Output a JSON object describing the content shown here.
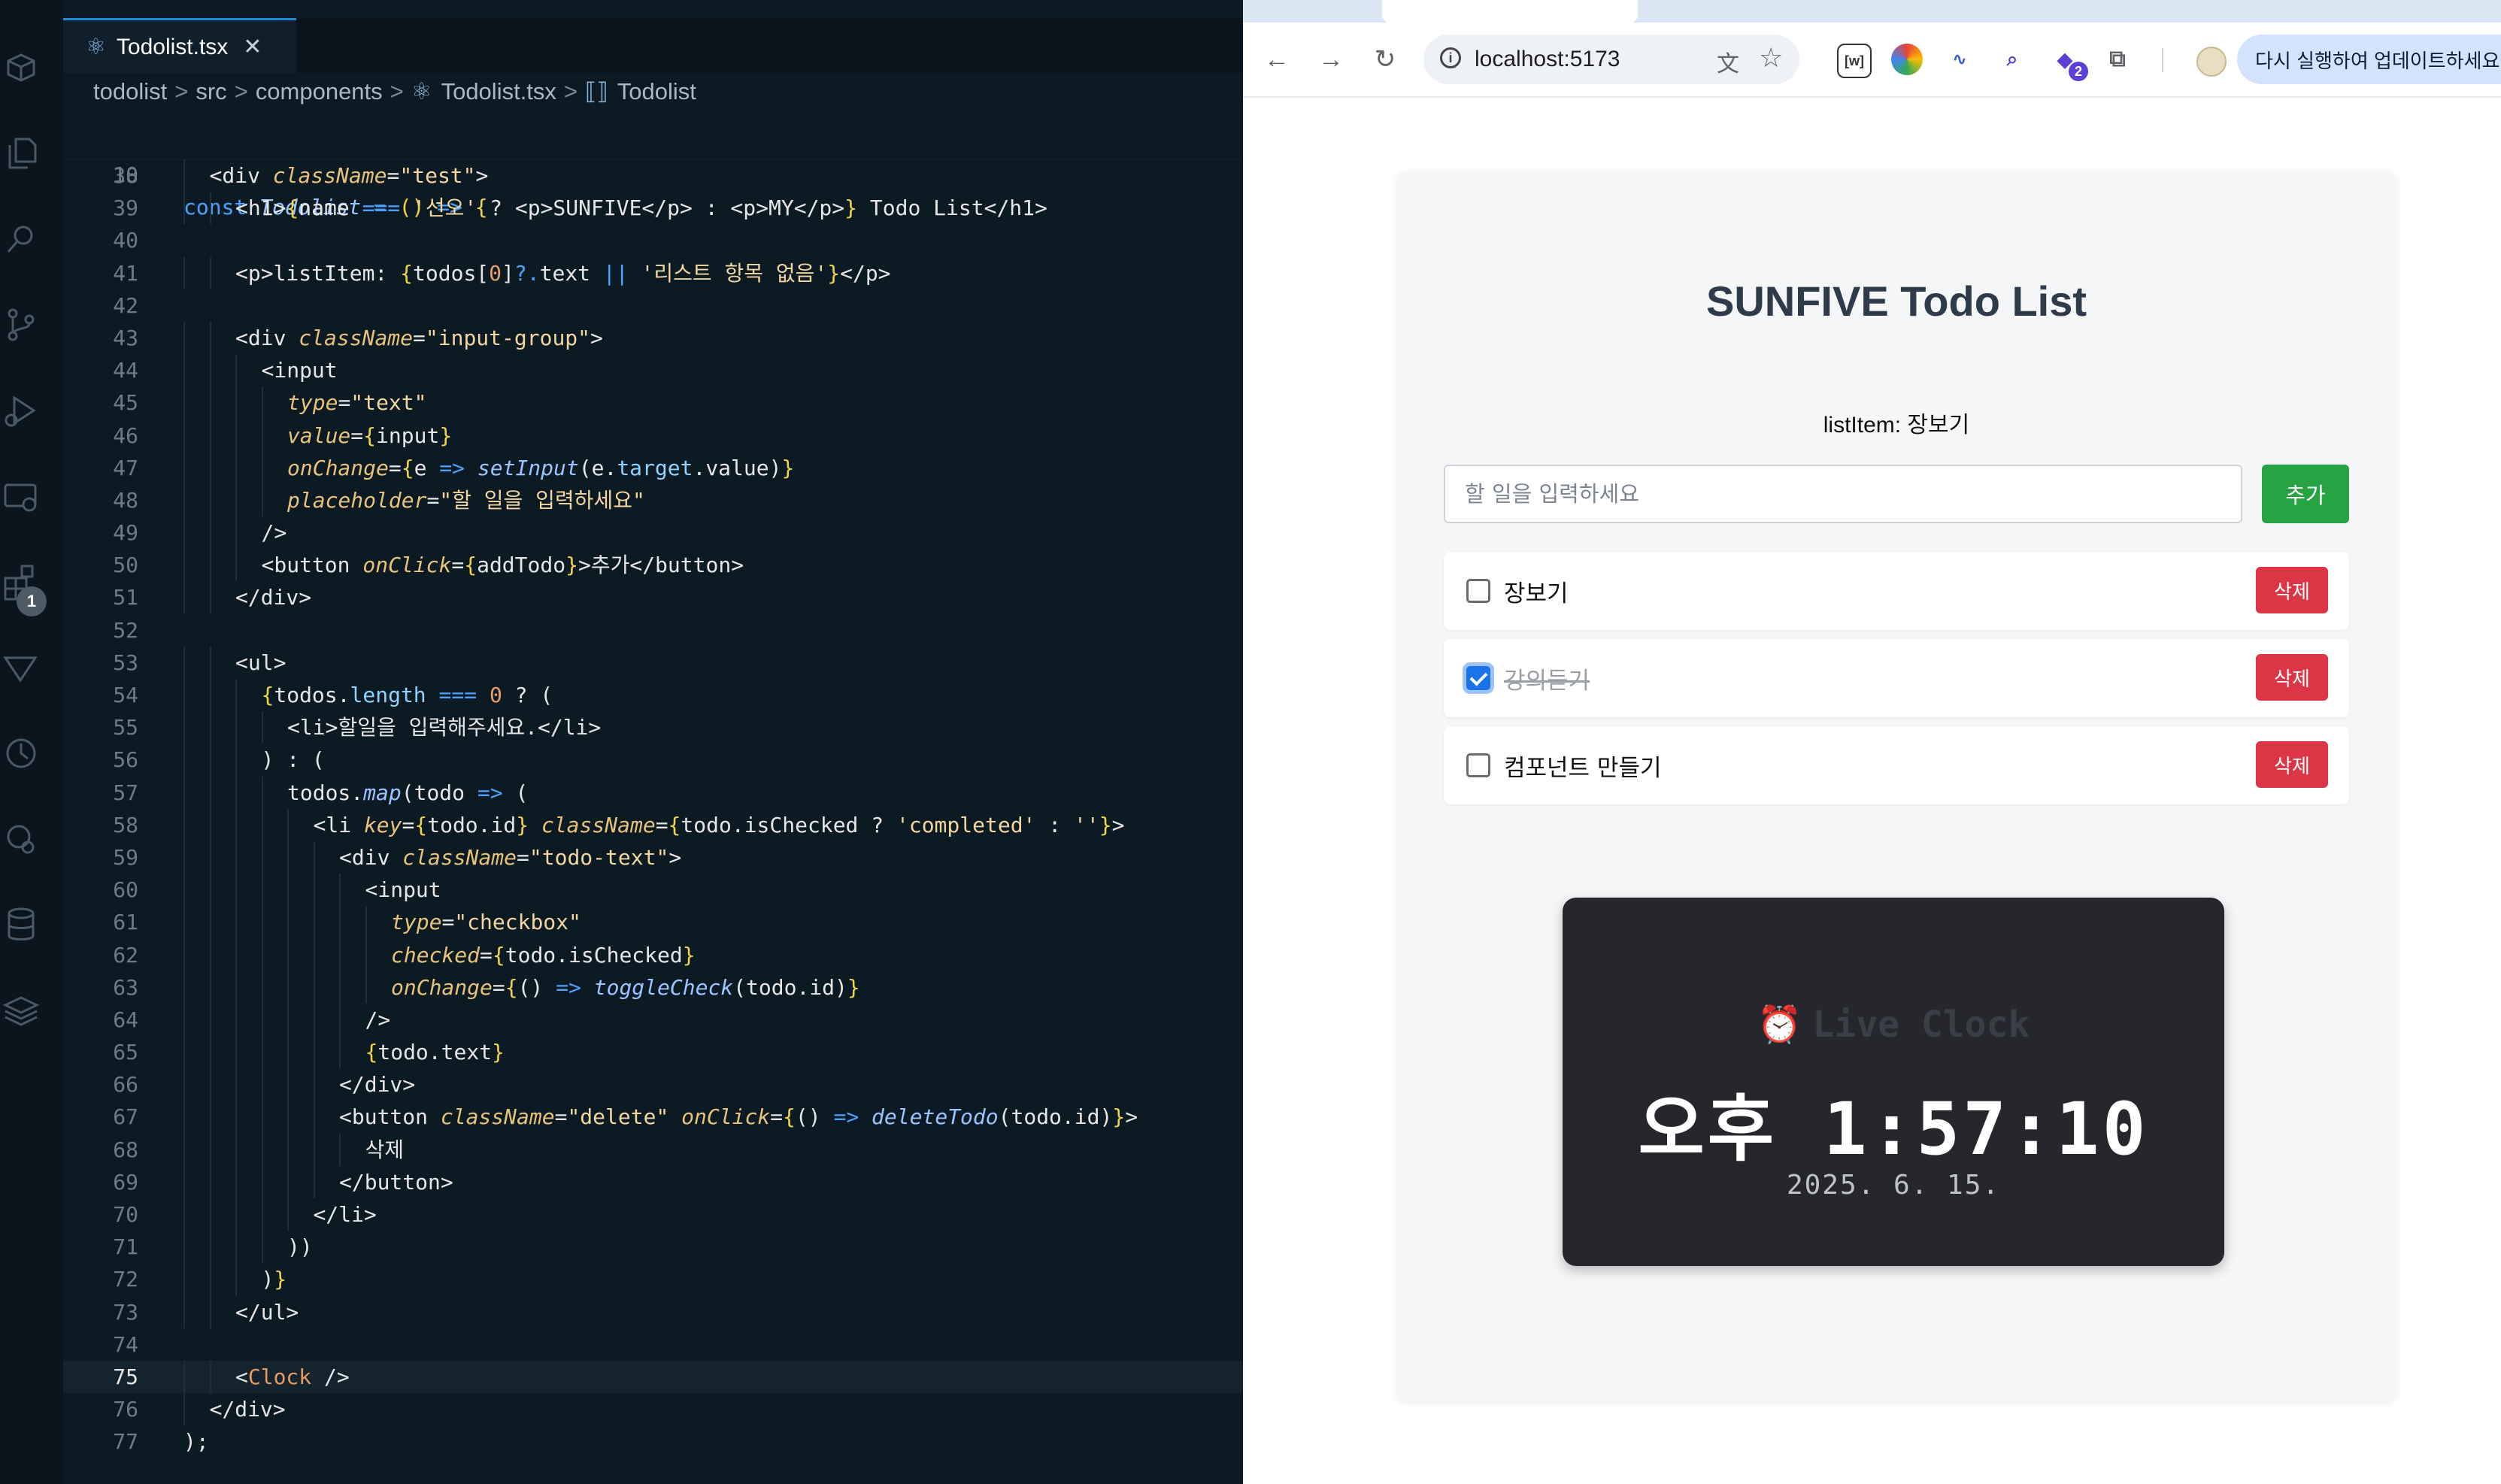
{
  "editor": {
    "tab": {
      "label": "Todolist.tsx",
      "close": "✕"
    },
    "breadcrumb": [
      "todolist",
      "src",
      "components",
      "Todolist.tsx",
      "Todolist"
    ],
    "breadcrumb_separator": ">",
    "explorer_badge": "1",
    "sticky": {
      "line_number": "10",
      "code": "const Todolist = () => {"
    },
    "current_line": "75",
    "lines": [
      {
        "n": "38",
        "i": 2,
        "t": "<div className=\"test\">"
      },
      {
        "n": "39",
        "i": 3,
        "t": "<h1>{name === '선오' ? <p>SUNFIVE</p> : <p>MY</p>} Todo List</h1>"
      },
      {
        "n": "40",
        "i": 0,
        "t": ""
      },
      {
        "n": "41",
        "i": 3,
        "t": "<p>listItem: {todos[0]?.text || '리스트 항목 없음'}</p>"
      },
      {
        "n": "42",
        "i": 0,
        "t": ""
      },
      {
        "n": "43",
        "i": 3,
        "t": "<div className=\"input-group\">"
      },
      {
        "n": "44",
        "i": 4,
        "t": "<input"
      },
      {
        "n": "45",
        "i": 5,
        "t": "type=\"text\""
      },
      {
        "n": "46",
        "i": 5,
        "t": "value={input}"
      },
      {
        "n": "47",
        "i": 5,
        "t": "onChange={e => setInput(e.target.value)}"
      },
      {
        "n": "48",
        "i": 5,
        "t": "placeholder=\"할 일을 입력하세요\""
      },
      {
        "n": "49",
        "i": 4,
        "t": "/>"
      },
      {
        "n": "50",
        "i": 4,
        "t": "<button onClick={addTodo}>추가</button>"
      },
      {
        "n": "51",
        "i": 3,
        "t": "</div>"
      },
      {
        "n": "52",
        "i": 0,
        "t": ""
      },
      {
        "n": "53",
        "i": 3,
        "t": "<ul>"
      },
      {
        "n": "54",
        "i": 4,
        "t": "{todos.length === 0 ? ("
      },
      {
        "n": "55",
        "i": 5,
        "t": "<li>할일을 입력해주세요.</li>"
      },
      {
        "n": "56",
        "i": 4,
        "t": ") : ("
      },
      {
        "n": "57",
        "i": 5,
        "t": "todos.map(todo => ("
      },
      {
        "n": "58",
        "i": 6,
        "t": "<li key={todo.id} className={todo.isChecked ? 'completed' : ''}>"
      },
      {
        "n": "59",
        "i": 7,
        "t": "<div className=\"todo-text\">"
      },
      {
        "n": "60",
        "i": 8,
        "t": "<input"
      },
      {
        "n": "61",
        "i": 9,
        "t": "type=\"checkbox\""
      },
      {
        "n": "62",
        "i": 9,
        "t": "checked={todo.isChecked}"
      },
      {
        "n": "63",
        "i": 9,
        "t": "onChange={() => toggleCheck(todo.id)}"
      },
      {
        "n": "64",
        "i": 8,
        "t": "/>"
      },
      {
        "n": "65",
        "i": 8,
        "t": "{todo.text}"
      },
      {
        "n": "66",
        "i": 7,
        "t": "</div>"
      },
      {
        "n": "67",
        "i": 7,
        "t": "<button className=\"delete\" onClick={() => deleteTodo(todo.id)}>"
      },
      {
        "n": "68",
        "i": 8,
        "t": "삭제"
      },
      {
        "n": "69",
        "i": 7,
        "t": "</button>"
      },
      {
        "n": "70",
        "i": 6,
        "t": "</li>"
      },
      {
        "n": "71",
        "i": 5,
        "t": "))"
      },
      {
        "n": "72",
        "i": 4,
        "t": ")}"
      },
      {
        "n": "73",
        "i": 3,
        "t": "</ul>"
      },
      {
        "n": "74",
        "i": 0,
        "t": ""
      },
      {
        "n": "75",
        "i": 3,
        "t": "<Clock />"
      },
      {
        "n": "76",
        "i": 2,
        "t": "</div>"
      },
      {
        "n": "77",
        "i": 1,
        "t": ");"
      }
    ]
  },
  "browser": {
    "url": "localhost:5173",
    "update_label": "다시 실행하여 업데이트하세요.",
    "extension_badge": "2"
  },
  "app": {
    "title": "SUNFIVE Todo List",
    "list_item_line": "listItem: 장보기",
    "input_placeholder": "할 일을 입력하세요",
    "add_label": "추가",
    "todos": [
      {
        "text": "장보기",
        "checked": false,
        "delete_label": "삭제"
      },
      {
        "text": "강의듣기",
        "checked": true,
        "delete_label": "삭제"
      },
      {
        "text": "컴포넌트 만들기",
        "checked": false,
        "delete_label": "삭제"
      }
    ],
    "clock": {
      "icon": "⏰",
      "title": "Live Clock",
      "time": "오후 1:57:10",
      "date": "2025. 6. 15."
    }
  },
  "colors": {
    "editor_bg": "#0c1a24",
    "accent_blue": "#1f8ad2",
    "add_button": "#27a344",
    "delete_button": "#dc3545",
    "clock_bg": "#25272c"
  }
}
